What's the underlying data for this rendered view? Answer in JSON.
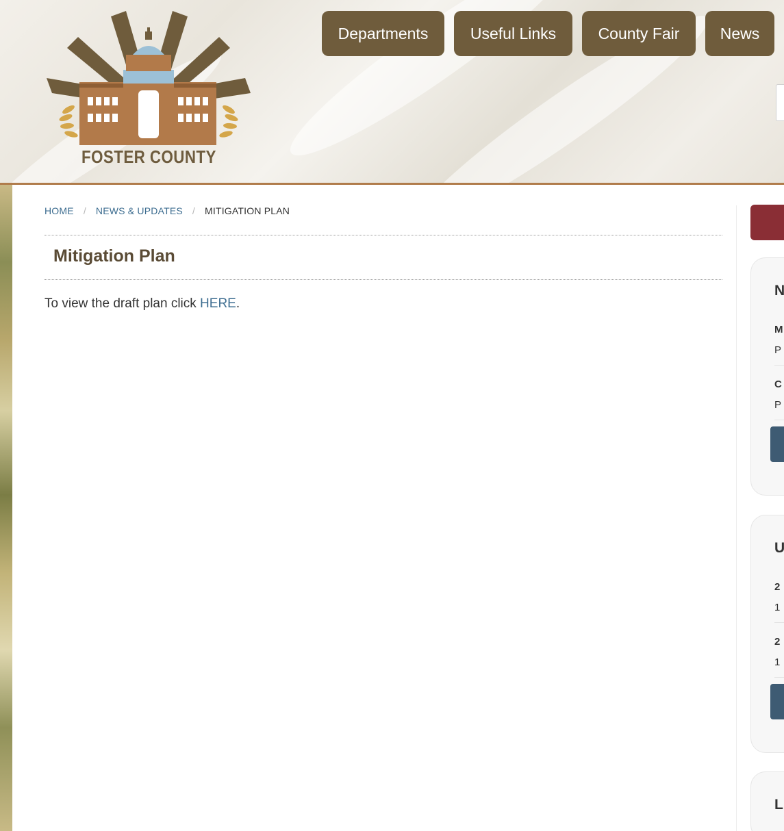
{
  "header": {
    "logo_text": "FOSTER COUNTY",
    "nav": [
      {
        "label": "Departments"
      },
      {
        "label": "Useful Links"
      },
      {
        "label": "County Fair"
      },
      {
        "label": "News"
      }
    ]
  },
  "breadcrumb": {
    "items": [
      {
        "label": "HOME"
      },
      {
        "label": "NEWS & UPDATES"
      },
      {
        "label": "MITIGATION PLAN"
      }
    ],
    "separator": "/"
  },
  "page": {
    "title": "Mitigation Plan",
    "body_prefix": "To view the draft plan click ",
    "body_link": "HERE",
    "body_suffix": "."
  },
  "sidebar": {
    "card1": {
      "heading": "N",
      "items": [
        {
          "line1": "M",
          "line2": "P"
        },
        {
          "line1": "C",
          "line2": "P"
        }
      ]
    },
    "card2": {
      "heading": "U",
      "items": [
        {
          "line1": "2",
          "line2": "1"
        },
        {
          "line1": "2",
          "line2": "1"
        }
      ]
    },
    "card3": {
      "heading": "L"
    }
  },
  "colors": {
    "nav_button": "#6f5c3c",
    "header_border": "#b07c4b",
    "link": "#3d6d90",
    "title": "#5a4b35",
    "sidebar_red": "#8a2e35",
    "sidebar_button": "#3e5b73"
  }
}
